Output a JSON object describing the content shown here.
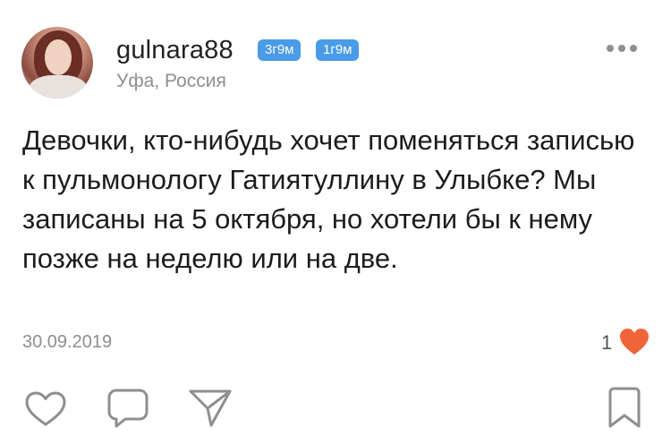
{
  "post": {
    "username": "gulnara88",
    "badges": [
      "3г9м",
      "1г9м"
    ],
    "location": "Уфа, Россия",
    "text": "Девочки, кто-нибудь хочет поменяться записью к пульмонологу Гатиятуллину в Улыбке? Мы записаны на 5 октября, но хотели бы к нему позже на неделю или на две.",
    "date": "30.09.2019",
    "like_count": "1"
  },
  "colors": {
    "badge": "#4a9be8",
    "like_heart": "#f0643a",
    "secondary_text": "#8e8e93",
    "icon_stroke": "#8e8e93"
  },
  "icons": {
    "more": "more-dots-icon",
    "liked": "heart-filled-icon",
    "like": "heart-outline-icon",
    "comment": "comment-icon",
    "share": "share-icon",
    "bookmark": "bookmark-icon"
  }
}
